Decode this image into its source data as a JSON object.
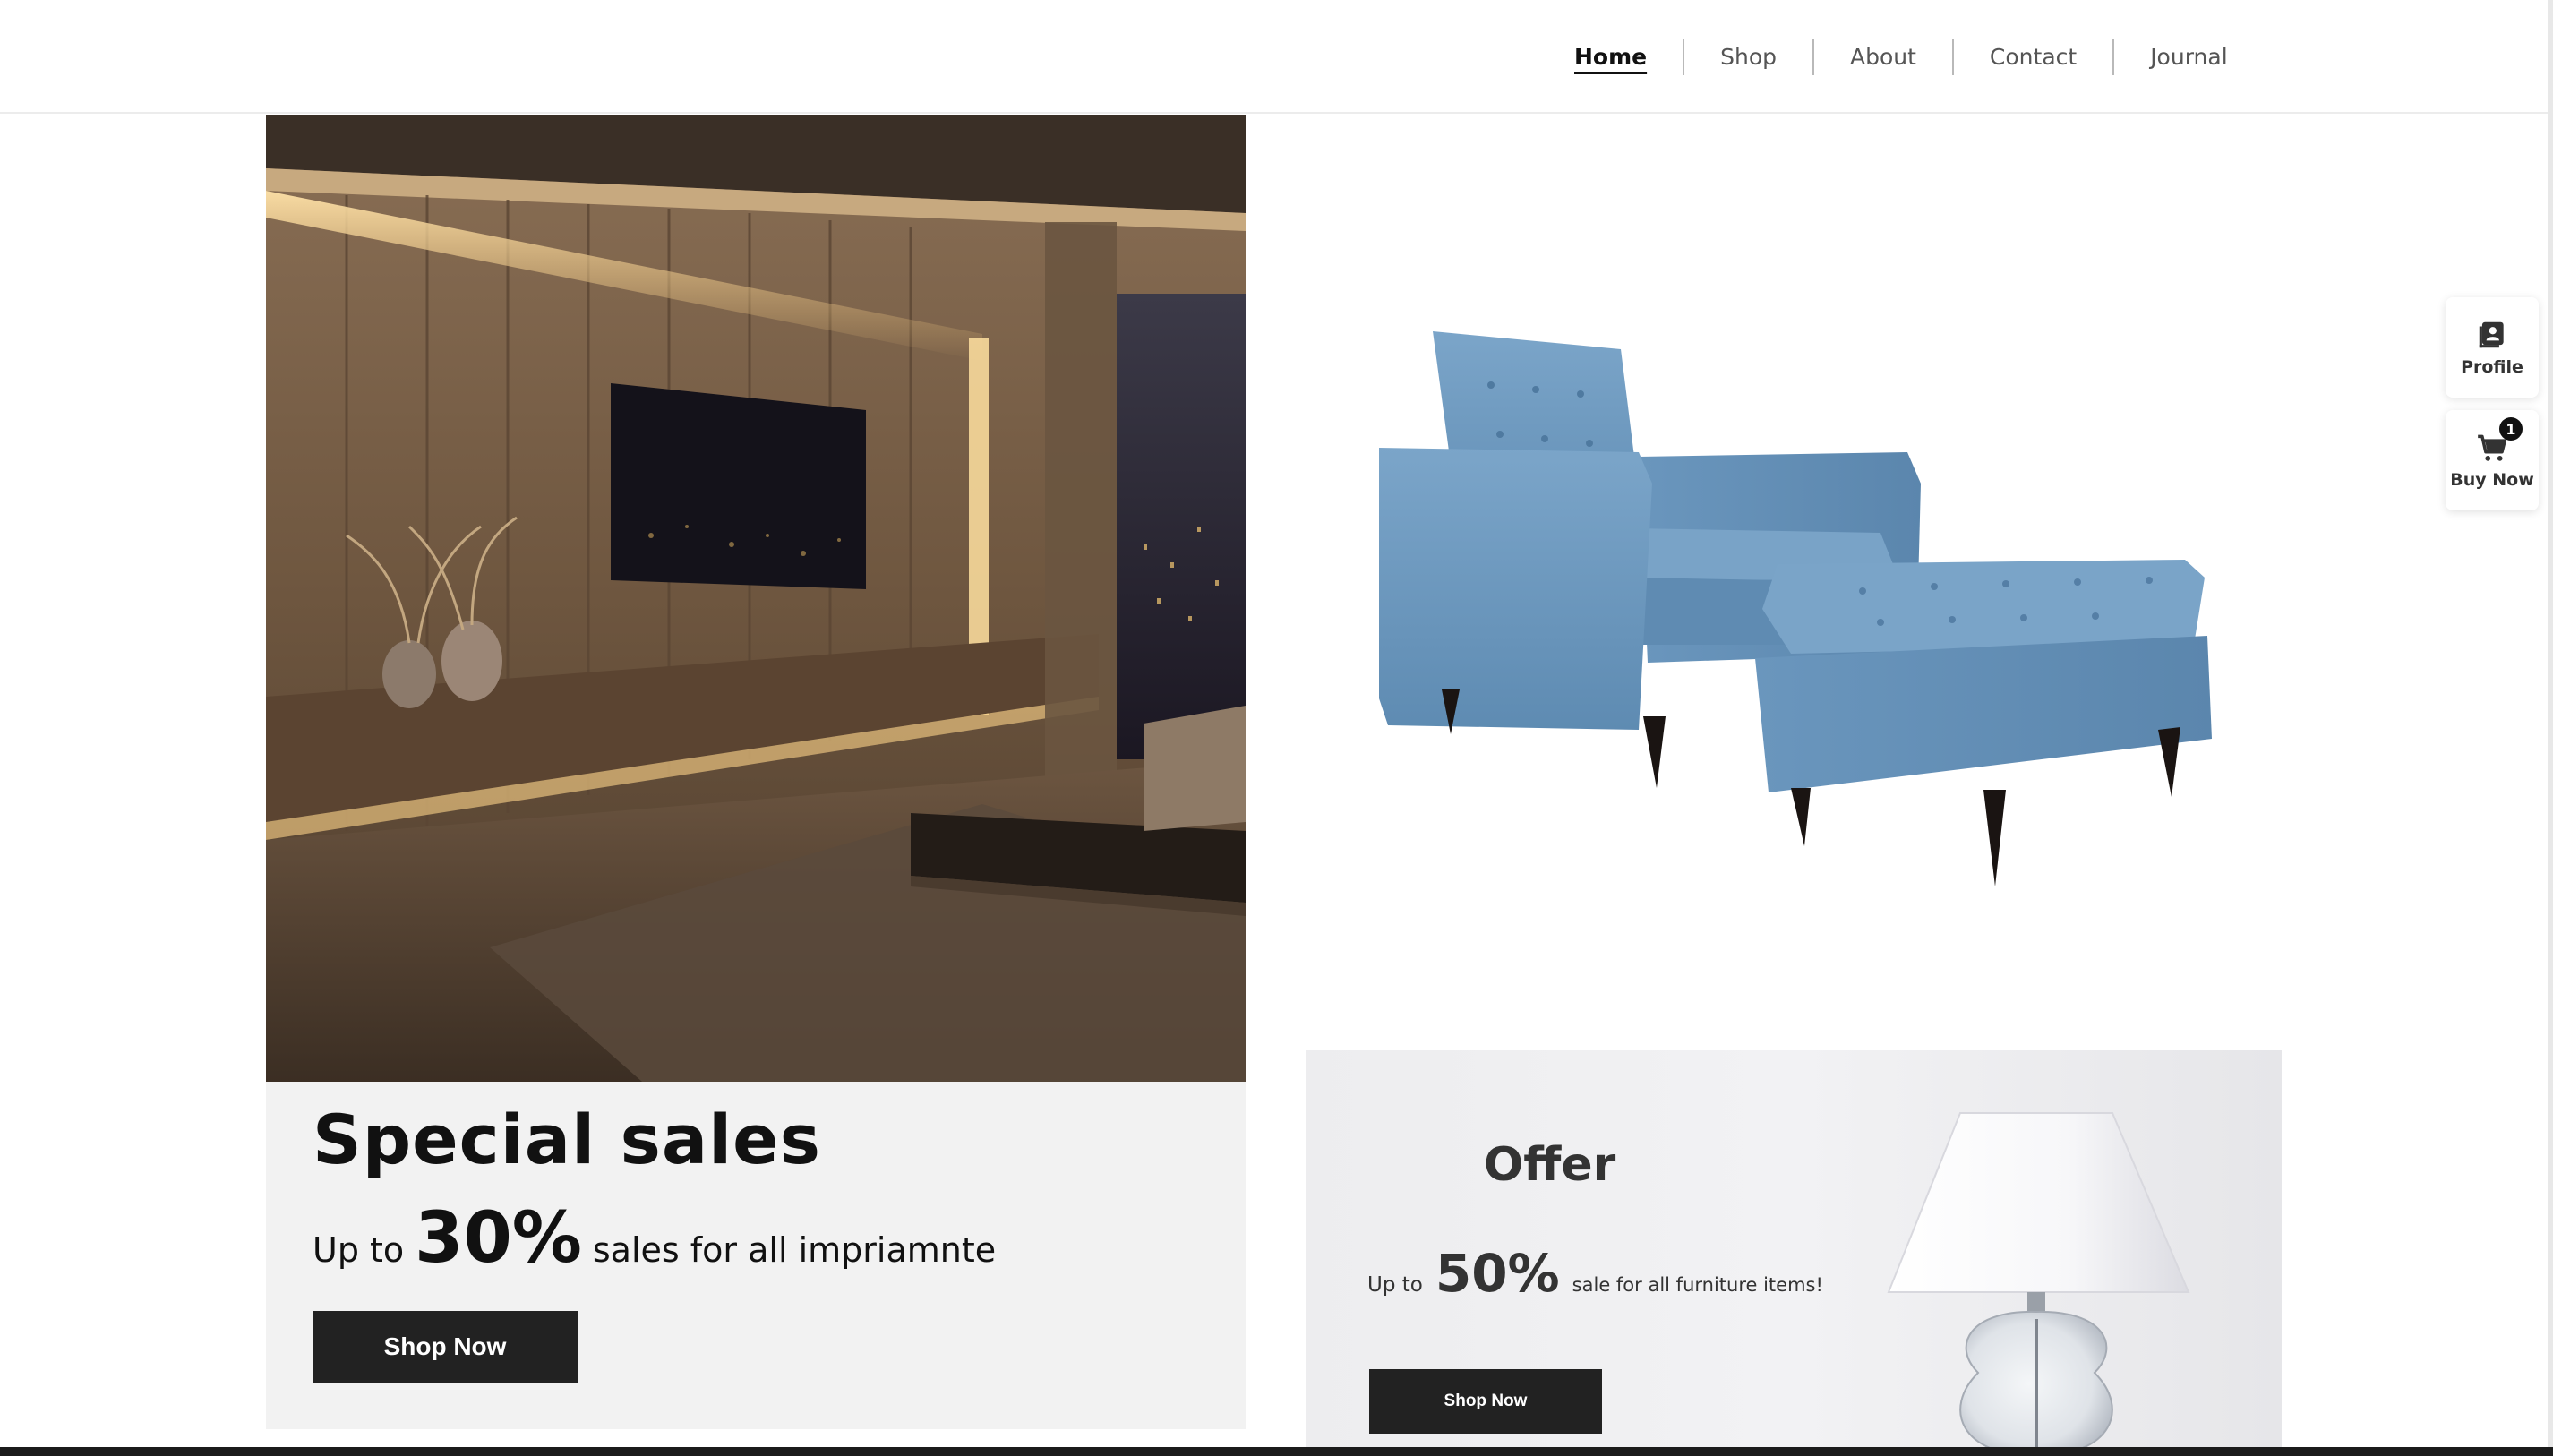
{
  "nav": {
    "items": [
      {
        "label": "Home",
        "active": true
      },
      {
        "label": "Shop",
        "active": false
      },
      {
        "label": "About",
        "active": false
      },
      {
        "label": "Contact",
        "active": false
      },
      {
        "label": "Journal",
        "active": false
      }
    ]
  },
  "special": {
    "title": "Special sales",
    "prefix": "Up to",
    "percent": "30%",
    "suffix": "sales for all impriamnte",
    "button": "Shop Now"
  },
  "offer": {
    "title": "Offer",
    "prefix": "Up to",
    "percent": "50%",
    "suffix": "sale for all furniture items!",
    "button": "Shop Now"
  },
  "side": {
    "profile_label": "Profile",
    "buy_label": "Buy Now",
    "cart_count": "1"
  },
  "colors": {
    "button_bg": "#222222",
    "promo_bg": "#f2f2f2",
    "chair_blue": "#6f9bc0"
  }
}
